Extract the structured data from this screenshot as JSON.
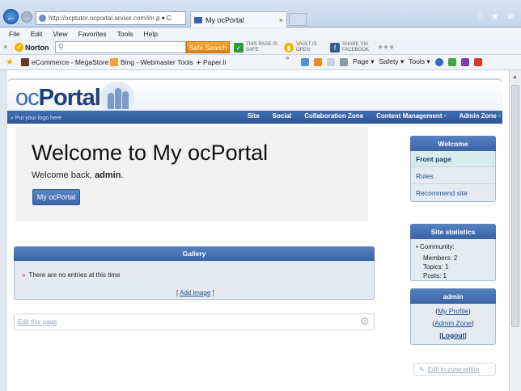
{
  "browser": {
    "address": "http://ocptutor.ocportal.arvixe.com/inde:",
    "address_controls": "ρ ▾ C",
    "tab_title": "My ocPortal",
    "tab_close": "×",
    "window_icons": [
      "⌂",
      "★",
      "✲"
    ],
    "menu": [
      "File",
      "Edit",
      "View",
      "Favorites",
      "Tools",
      "Help"
    ],
    "norton": {
      "close": "×",
      "brand": "Norton",
      "search_placeholder": "",
      "search_icon": "⚲",
      "safe_search": "Safe Search",
      "page_safe_l1": "THIS PAGE IS",
      "page_safe_l2": "SAFE",
      "vault_l1": "VAULT IS",
      "vault_l2": "OPEN",
      "share_l1": "SHARE VIA",
      "share_l2": "FACEBOOK",
      "more": "●●●"
    },
    "favorites": [
      "eCommerce - MegaStore ...",
      "Bing - Webmaster Tools",
      "Paper.li"
    ],
    "favorites_more": "»",
    "commands": [
      "Page ▾",
      "Safety ▾",
      "Tools ▾"
    ]
  },
  "site": {
    "logo_oc": "oc",
    "logo_portal": "Portal",
    "tagline": "» Put your logo here",
    "nav": [
      "Site",
      "Social",
      "Collaboration Zone",
      "Content Management ▫",
      "Admin Zone ▫"
    ]
  },
  "main": {
    "title": "Welcome to My ocPortal",
    "welcome_prefix": "Welcome back,",
    "welcome_user": "admin",
    "welcome_suffix": ".",
    "button": "My ocPortal",
    "gallery_title": "Gallery",
    "gallery_bullet": "»",
    "gallery_empty": "There are no entries at this time",
    "add_image_open": "[",
    "add_image": "Add image",
    "add_image_close": "]",
    "edit_page": "Edit this page",
    "gear": "⚙"
  },
  "sidebar": {
    "welcome_title": "Welcome",
    "menu": [
      "Front page",
      "Rules",
      "Recommend site"
    ],
    "stats_title": "Site statistics",
    "community_label": "Community:",
    "members": "Members: 2",
    "topics": "Topics: 1",
    "posts": "Posts: 1",
    "admin_title": "admin",
    "links": [
      "My Profile",
      "Admin Zone",
      "Logout"
    ],
    "zone_editor": "Edit in zone editor"
  }
}
